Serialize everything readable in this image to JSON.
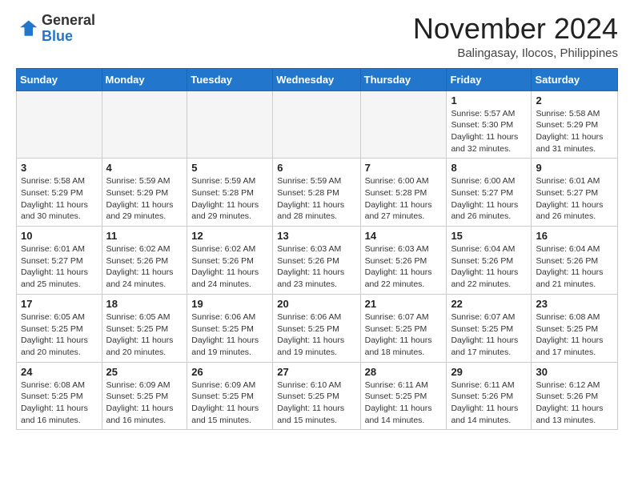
{
  "header": {
    "logo_general": "General",
    "logo_blue": "Blue",
    "month_title": "November 2024",
    "location": "Balingasay, Ilocos, Philippines"
  },
  "days_of_week": [
    "Sunday",
    "Monday",
    "Tuesday",
    "Wednesday",
    "Thursday",
    "Friday",
    "Saturday"
  ],
  "weeks": [
    [
      {
        "day": "",
        "info": ""
      },
      {
        "day": "",
        "info": ""
      },
      {
        "day": "",
        "info": ""
      },
      {
        "day": "",
        "info": ""
      },
      {
        "day": "",
        "info": ""
      },
      {
        "day": "1",
        "info": "Sunrise: 5:57 AM\nSunset: 5:30 PM\nDaylight: 11 hours\nand 32 minutes."
      },
      {
        "day": "2",
        "info": "Sunrise: 5:58 AM\nSunset: 5:29 PM\nDaylight: 11 hours\nand 31 minutes."
      }
    ],
    [
      {
        "day": "3",
        "info": "Sunrise: 5:58 AM\nSunset: 5:29 PM\nDaylight: 11 hours\nand 30 minutes."
      },
      {
        "day": "4",
        "info": "Sunrise: 5:59 AM\nSunset: 5:29 PM\nDaylight: 11 hours\nand 29 minutes."
      },
      {
        "day": "5",
        "info": "Sunrise: 5:59 AM\nSunset: 5:28 PM\nDaylight: 11 hours\nand 29 minutes."
      },
      {
        "day": "6",
        "info": "Sunrise: 5:59 AM\nSunset: 5:28 PM\nDaylight: 11 hours\nand 28 minutes."
      },
      {
        "day": "7",
        "info": "Sunrise: 6:00 AM\nSunset: 5:28 PM\nDaylight: 11 hours\nand 27 minutes."
      },
      {
        "day": "8",
        "info": "Sunrise: 6:00 AM\nSunset: 5:27 PM\nDaylight: 11 hours\nand 26 minutes."
      },
      {
        "day": "9",
        "info": "Sunrise: 6:01 AM\nSunset: 5:27 PM\nDaylight: 11 hours\nand 26 minutes."
      }
    ],
    [
      {
        "day": "10",
        "info": "Sunrise: 6:01 AM\nSunset: 5:27 PM\nDaylight: 11 hours\nand 25 minutes."
      },
      {
        "day": "11",
        "info": "Sunrise: 6:02 AM\nSunset: 5:26 PM\nDaylight: 11 hours\nand 24 minutes."
      },
      {
        "day": "12",
        "info": "Sunrise: 6:02 AM\nSunset: 5:26 PM\nDaylight: 11 hours\nand 24 minutes."
      },
      {
        "day": "13",
        "info": "Sunrise: 6:03 AM\nSunset: 5:26 PM\nDaylight: 11 hours\nand 23 minutes."
      },
      {
        "day": "14",
        "info": "Sunrise: 6:03 AM\nSunset: 5:26 PM\nDaylight: 11 hours\nand 22 minutes."
      },
      {
        "day": "15",
        "info": "Sunrise: 6:04 AM\nSunset: 5:26 PM\nDaylight: 11 hours\nand 22 minutes."
      },
      {
        "day": "16",
        "info": "Sunrise: 6:04 AM\nSunset: 5:26 PM\nDaylight: 11 hours\nand 21 minutes."
      }
    ],
    [
      {
        "day": "17",
        "info": "Sunrise: 6:05 AM\nSunset: 5:25 PM\nDaylight: 11 hours\nand 20 minutes."
      },
      {
        "day": "18",
        "info": "Sunrise: 6:05 AM\nSunset: 5:25 PM\nDaylight: 11 hours\nand 20 minutes."
      },
      {
        "day": "19",
        "info": "Sunrise: 6:06 AM\nSunset: 5:25 PM\nDaylight: 11 hours\nand 19 minutes."
      },
      {
        "day": "20",
        "info": "Sunrise: 6:06 AM\nSunset: 5:25 PM\nDaylight: 11 hours\nand 19 minutes."
      },
      {
        "day": "21",
        "info": "Sunrise: 6:07 AM\nSunset: 5:25 PM\nDaylight: 11 hours\nand 18 minutes."
      },
      {
        "day": "22",
        "info": "Sunrise: 6:07 AM\nSunset: 5:25 PM\nDaylight: 11 hours\nand 17 minutes."
      },
      {
        "day": "23",
        "info": "Sunrise: 6:08 AM\nSunset: 5:25 PM\nDaylight: 11 hours\nand 17 minutes."
      }
    ],
    [
      {
        "day": "24",
        "info": "Sunrise: 6:08 AM\nSunset: 5:25 PM\nDaylight: 11 hours\nand 16 minutes."
      },
      {
        "day": "25",
        "info": "Sunrise: 6:09 AM\nSunset: 5:25 PM\nDaylight: 11 hours\nand 16 minutes."
      },
      {
        "day": "26",
        "info": "Sunrise: 6:09 AM\nSunset: 5:25 PM\nDaylight: 11 hours\nand 15 minutes."
      },
      {
        "day": "27",
        "info": "Sunrise: 6:10 AM\nSunset: 5:25 PM\nDaylight: 11 hours\nand 15 minutes."
      },
      {
        "day": "28",
        "info": "Sunrise: 6:11 AM\nSunset: 5:25 PM\nDaylight: 11 hours\nand 14 minutes."
      },
      {
        "day": "29",
        "info": "Sunrise: 6:11 AM\nSunset: 5:26 PM\nDaylight: 11 hours\nand 14 minutes."
      },
      {
        "day": "30",
        "info": "Sunrise: 6:12 AM\nSunset: 5:26 PM\nDaylight: 11 hours\nand 13 minutes."
      }
    ]
  ]
}
